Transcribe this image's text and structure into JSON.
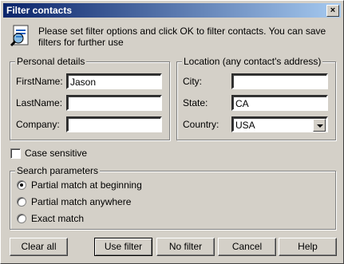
{
  "window": {
    "title": "Filter contacts",
    "close_glyph": "×"
  },
  "info": {
    "text": "Please set filter options and click OK to filter contacts. You can save filters for further use",
    "icon": "filter-document-icon"
  },
  "personal": {
    "title": "Personal details",
    "first_label": "FirstName:",
    "first_value": "Jason",
    "last_label": "LastName:",
    "last_value": "",
    "company_label": "Company:",
    "company_value": ""
  },
  "location": {
    "title": "Location (any contact's address)",
    "city_label": "City:",
    "city_value": "",
    "state_label": "State:",
    "state_value": "CA",
    "country_label": "Country:",
    "country_value": "USA"
  },
  "case_sensitive": {
    "label": "Case sensitive",
    "checked": false
  },
  "search": {
    "title": "Search parameters",
    "opt1": "Partial match at beginning",
    "opt2": "Partial match anywhere",
    "opt3": "Exact match",
    "selected": "Partial match at beginning"
  },
  "buttons": {
    "clear": "Clear all",
    "use": "Use filter",
    "nofilter": "No filter",
    "cancel": "Cancel",
    "help": "Help"
  }
}
